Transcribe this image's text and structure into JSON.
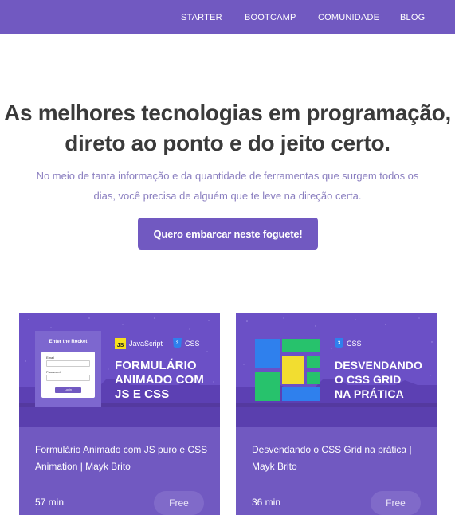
{
  "nav": {
    "items": [
      "STARTER",
      "BOOTCAMP",
      "COMUNIDADE",
      "BLOG"
    ]
  },
  "hero": {
    "title_line1": "As melhores tecnologias em programação,",
    "title_line2": "direto ao ponto e do jeito certo.",
    "subtitle_line1": "No meio de tanta informação e da quantidade de ferramentas que surgem todos os",
    "subtitle_line2": "dias, você precisa de alguém que te leve na direção certa.",
    "cta_label": "Quero embarcar neste foguete!"
  },
  "cards": [
    {
      "thumb_mock_title": "Enter the Rocket",
      "thumb_mock_email": "Email",
      "thumb_mock_password": "Password",
      "thumb_mock_button": "Login",
      "thumb_tag1_icon": "JS",
      "thumb_tag1": "JavaScript",
      "thumb_tag2_icon": "3",
      "thumb_tag2": "CSS",
      "thumb_title_line1": "FORMULÁRIO",
      "thumb_title_line2": "ANIMADO COM",
      "thumb_title_line3": "JS E CSS",
      "title": "Formulário Animado com JS puro e CSS Animation | Mayk Brito",
      "duration": "57 min",
      "price": "Free"
    },
    {
      "thumb_tag1_icon": "3",
      "thumb_tag1": "CSS",
      "thumb_title_line1": "DESVENDANDO",
      "thumb_title_line2": "O CSS GRID",
      "thumb_title_line3": "NA PRÁTICA",
      "title": "Desvendando o CSS Grid na prática | Mayk Brito",
      "duration": "36 min",
      "price": "Free"
    }
  ],
  "colors": {
    "brand": "#7159c1",
    "text_dark": "#3a3a3a",
    "text_muted": "#8b7fc0",
    "js_yellow": "#f7df1e",
    "css_blue": "#2f80ed"
  },
  "icons": {
    "js_badge": "javascript-icon",
    "css_badge": "css3-icon"
  }
}
